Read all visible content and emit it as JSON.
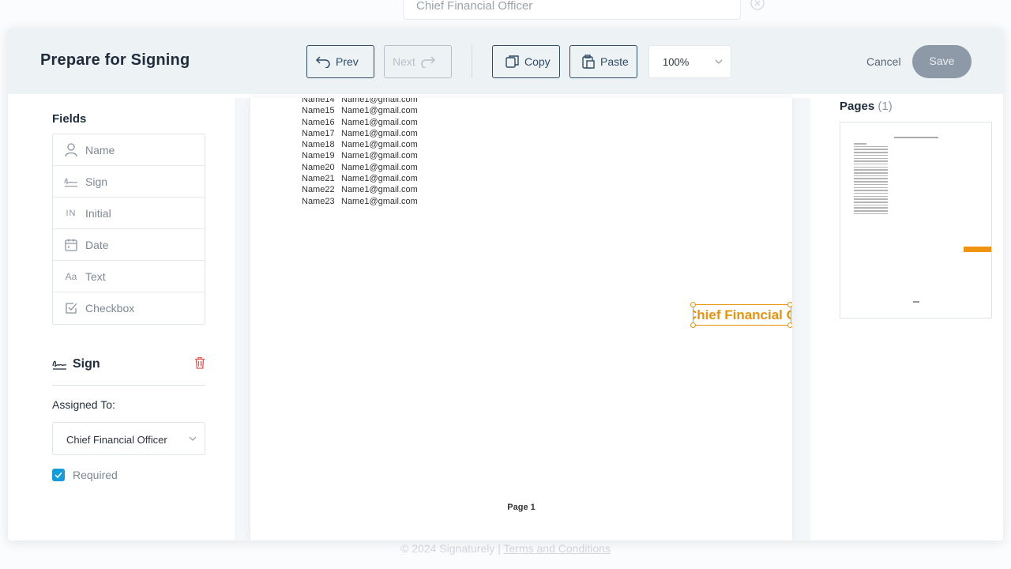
{
  "background": {
    "assignee_input_value": "Chief Financial Officer",
    "footer_copyright": "© 2024 Signaturely |",
    "footer_link": "Terms and Conditions"
  },
  "header": {
    "title": "Prepare for Signing",
    "prev_label": "Prev",
    "next_label": "Next",
    "copy_label": "Copy",
    "paste_label": "Paste",
    "zoom_value": "100%",
    "cancel_label": "Cancel",
    "save_label": "Save"
  },
  "sidebar": {
    "fields_title": "Fields",
    "fields": [
      {
        "label": "Name",
        "icon": "person-icon"
      },
      {
        "label": "Sign",
        "icon": "signature-icon"
      },
      {
        "label": "Initial",
        "icon": "initial-icon"
      },
      {
        "label": "Date",
        "icon": "calendar-icon"
      },
      {
        "label": "Text",
        "icon": "text-icon"
      },
      {
        "label": "Checkbox",
        "icon": "checkbox-icon"
      }
    ],
    "selected_field_title": "Sign",
    "assigned_label": "Assigned To:",
    "assigned_value": "Chief Financial Officer",
    "required_label": "Required",
    "required_checked": true
  },
  "document": {
    "rows": [
      {
        "name": "Name14",
        "email": "Name1@gmail.com"
      },
      {
        "name": "Name15",
        "email": "Name1@gmail.com"
      },
      {
        "name": "Name16",
        "email": "Name1@gmail.com"
      },
      {
        "name": "Name17",
        "email": "Name1@gmail.com"
      },
      {
        "name": "Name18",
        "email": "Name1@gmail.com"
      },
      {
        "name": "Name19",
        "email": "Name1@gmail.com"
      },
      {
        "name": "Name20",
        "email": "Name1@gmail.com"
      },
      {
        "name": "Name21",
        "email": "Name1@gmail.com"
      },
      {
        "name": "Name22",
        "email": "Name1@gmail.com"
      },
      {
        "name": "Name23",
        "email": "Name1@gmail.com"
      }
    ],
    "page_label": "Page 1",
    "placed_field_text": "Chief Financial Officer",
    "placed_field_color": "#e8930e"
  },
  "pages_panel": {
    "title": "Pages",
    "count": "(1)"
  },
  "colors": {
    "accent": "#159bd9",
    "header_bg": "#edf2f5",
    "save_disabled": "#8d99a6",
    "trash": "#e5534b"
  }
}
